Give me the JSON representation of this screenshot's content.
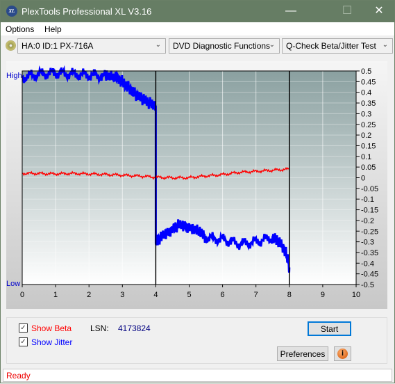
{
  "window": {
    "title": "PlexTools Professional XL V3.16",
    "logo": "XL"
  },
  "menu": [
    "Options",
    "Help"
  ],
  "toolbar": {
    "drive": "HA:0 ID:1  PX-716A",
    "function": "DVD Diagnostic Functions",
    "test": "Q-Check Beta/Jitter Test"
  },
  "chart_data": {
    "type": "line",
    "left_labels": {
      "top": "High",
      "bottom": "Low"
    },
    "xlim": [
      0,
      10
    ],
    "ylim": [
      -0.5,
      0.5
    ],
    "x_ticks": [
      0,
      1,
      2,
      3,
      4,
      5,
      6,
      7,
      8,
      9,
      10
    ],
    "y_ticks": [
      0.5,
      0.45,
      0.4,
      0.35,
      0.3,
      0.25,
      0.2,
      0.15,
      0.1,
      0.05,
      0,
      -0.05,
      -0.1,
      -0.15,
      -0.2,
      -0.25,
      -0.3,
      -0.35,
      -0.4,
      -0.45,
      -0.5
    ],
    "markers": [
      4,
      8
    ],
    "grid": true,
    "series": [
      {
        "key": "jitter",
        "color": "#0000ff",
        "x": [
          0,
          0.5,
          1,
          1.5,
          2,
          2.5,
          2.8,
          3,
          3.2,
          3.4,
          3.6,
          3.8,
          4,
          4.01,
          4.2,
          4.5,
          4.7,
          5,
          5.3,
          5.5,
          6,
          6.5,
          7,
          7.5,
          7.7,
          7.9,
          8
        ],
        "y": [
          0.47,
          0.485,
          0.49,
          0.485,
          0.48,
          0.475,
          0.47,
          0.45,
          0.42,
          0.39,
          0.37,
          0.35,
          0.34,
          -0.3,
          -0.27,
          -0.24,
          -0.22,
          -0.23,
          -0.25,
          -0.28,
          -0.29,
          -0.31,
          -0.3,
          -0.28,
          -0.3,
          -0.35,
          -0.42
        ]
      },
      {
        "key": "beta",
        "color": "#ff0000",
        "x": [
          0,
          0.5,
          1,
          1.5,
          2,
          2.5,
          3,
          3.5,
          4,
          4.5,
          5,
          5.5,
          6,
          6.5,
          7,
          7.5,
          8
        ],
        "y": [
          0.02,
          0.02,
          0.018,
          0.02,
          0.018,
          0.015,
          0.012,
          0.008,
          0.002,
          0.0,
          0.0,
          0.008,
          0.015,
          0.025,
          0.03,
          0.035,
          0.04
        ]
      }
    ]
  },
  "controls": {
    "show_beta": "Show Beta",
    "show_jitter": "Show Jitter",
    "lsn_label": "LSN:",
    "lsn_value": "4173824",
    "start": "Start",
    "preferences": "Preferences"
  },
  "colors": {
    "beta": "#ff0000",
    "jitter": "#0000ff",
    "titlebar": "#667d64"
  },
  "status": "Ready"
}
